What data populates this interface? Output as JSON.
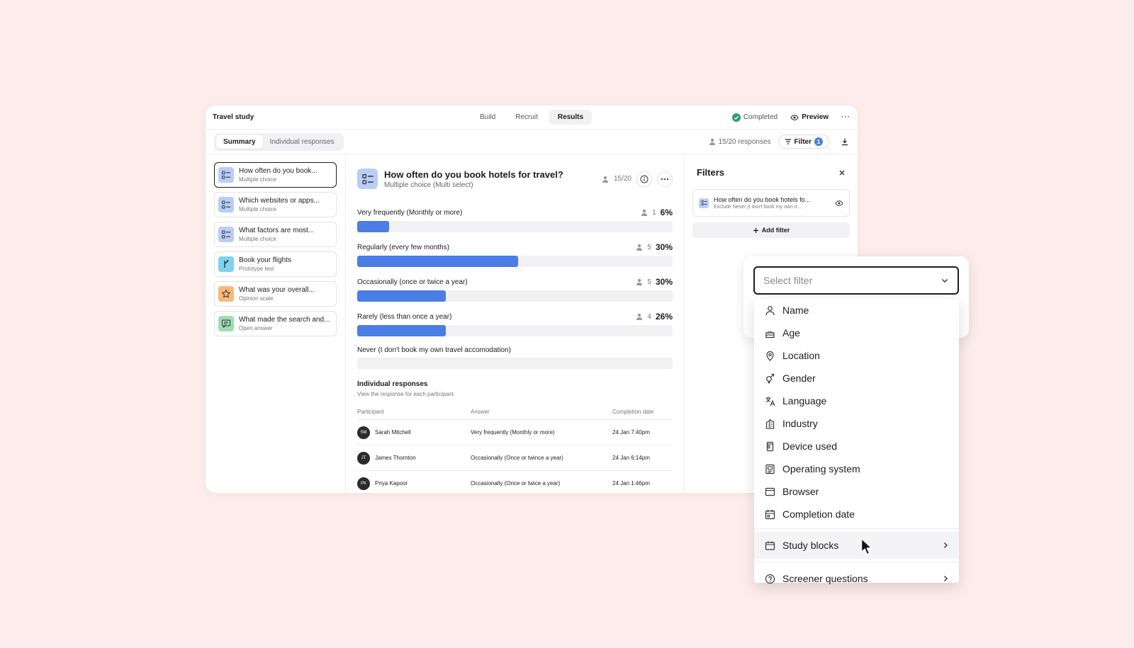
{
  "app": {
    "title": "Travel study",
    "nav_tabs": [
      {
        "label": "Build",
        "active": false
      },
      {
        "label": "Recruit",
        "active": false
      },
      {
        "label": "Results",
        "active": true
      }
    ],
    "status_label": "Completed",
    "status_color": "#2e9e6b",
    "preview_label": "Preview",
    "more_label": "···"
  },
  "subbar": {
    "tabs": [
      "Summary",
      "Individual responses"
    ],
    "responses_label": "15/20 responses",
    "filter_label": "Filter",
    "filter_count": "1"
  },
  "sidebar": {
    "items": [
      {
        "title": "How often do you book...",
        "type": "Multiple choice",
        "icon": "list-icon",
        "color": "#b9cdf6"
      },
      {
        "title": "Which websites or apps...",
        "type": "Multiple choice",
        "icon": "list-icon",
        "color": "#b9cdf6"
      },
      {
        "title": "What factors are most...",
        "type": "Multiple choice",
        "icon": "list-icon",
        "color": "#b9cdf6"
      },
      {
        "title": "Book your flights",
        "type": "Prototype test",
        "icon": "branch-icon",
        "color": "#7fd3ec"
      },
      {
        "title": "What was your overall...",
        "type": "Opinion scale",
        "icon": "star-icon",
        "color": "#f5b97c"
      },
      {
        "title": "What made the search and...",
        "type": "Open answer",
        "icon": "chat-icon",
        "color": "#9fdcb0"
      }
    ]
  },
  "question": {
    "title": "How often do you book hotels for travel?",
    "subtitle": "Multiple choice (Multi select)",
    "count": "15/20",
    "options": [
      {
        "label": "Very frequently (Monthly or more)",
        "count": "1",
        "pct": "6%",
        "fill": 0.1
      },
      {
        "label": "Regularly (every few months)",
        "count": "5",
        "pct": "30%",
        "fill": 0.51
      },
      {
        "label": "Occasionally (once or twice a year)",
        "count": "5",
        "pct": "30%",
        "fill": 0.28
      },
      {
        "label": "Rarely (less than once a year)",
        "count": "4",
        "pct": "26%",
        "fill": 0.28
      },
      {
        "label": "Never (I don't book my own travel accomodation)",
        "count": "",
        "pct": "",
        "fill": 0
      }
    ]
  },
  "individual": {
    "title": "Individual responses",
    "subtitle": "View the response for each participant",
    "headers": [
      "Participant",
      "Answer",
      "Completion date"
    ],
    "rows": [
      {
        "initials": "SM",
        "name": "Sarah Mitchell",
        "answer": "Very frequently (Monthly or more)",
        "date": "24 Jan 7:40pm"
      },
      {
        "initials": "JT",
        "name": "James Thornton",
        "answer": "Occasionally (Once or twince a year)",
        "date": "24 Jan 6:14pm"
      },
      {
        "initials": "PK",
        "name": "Priya Kapoor",
        "answer": "Occasionally (Once or twice a year)",
        "date": "24 Jan 1:46pm"
      }
    ]
  },
  "filters": {
    "title": "Filters",
    "card_title": "How often do you book hotels fo...",
    "card_sub": "Exclude Never (I don't book my own tr...",
    "add_label": "Add filter"
  },
  "select": {
    "placeholder": "Select filter",
    "items": [
      {
        "label": "Name",
        "icon": "person-icon"
      },
      {
        "label": "Age",
        "icon": "cake-icon"
      },
      {
        "label": "Location",
        "icon": "location-pin-icon"
      },
      {
        "label": "Gender",
        "icon": "gender-icon"
      },
      {
        "label": "Language",
        "icon": "translate-icon"
      },
      {
        "label": "Industry",
        "icon": "building-icon"
      },
      {
        "label": "Device used",
        "icon": "device-icon"
      },
      {
        "label": "Operating system",
        "icon": "os-icon"
      },
      {
        "label": "Browser",
        "icon": "browser-icon"
      },
      {
        "label": "Completion date",
        "icon": "calendar-icon"
      }
    ],
    "submenus": [
      {
        "label": "Study blocks",
        "icon": "blocks-icon"
      },
      {
        "label": "Screener questions",
        "icon": "question-circle-icon"
      }
    ]
  },
  "colors": {
    "accent": "#4a7de6",
    "background": "#fdecec"
  }
}
